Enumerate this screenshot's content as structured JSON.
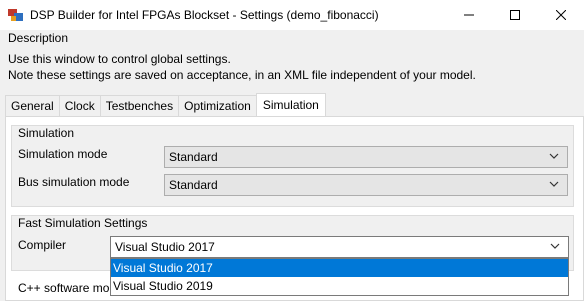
{
  "window": {
    "title": "DSP Builder for Intel FPGAs Blockset - Settings (demo_fibonacci)",
    "controls": [
      "minimize-icon",
      "maximize-icon",
      "close-icon"
    ]
  },
  "description": {
    "label": "Description",
    "line1": "Use this window to control global settings.",
    "line2": "Note these settings are saved on acceptance, in an XML file independent of your model."
  },
  "tabs": [
    {
      "label": "General",
      "active": false
    },
    {
      "label": "Clock",
      "active": false
    },
    {
      "label": "Testbenches",
      "active": false
    },
    {
      "label": "Optimization",
      "active": false
    },
    {
      "label": "Simulation",
      "active": true
    }
  ],
  "simulation": {
    "title": "Simulation",
    "mode_label": "Simulation mode",
    "mode_value": "Standard",
    "bus_label": "Bus simulation mode",
    "bus_value": "Standard"
  },
  "fast_sim": {
    "title": "Fast Simulation Settings",
    "compiler_label": "Compiler",
    "compiler_value": "Visual Studio 2017",
    "options": [
      "Visual Studio 2017",
      "Visual Studio 2019"
    ],
    "selected_option": "Visual Studio 2017"
  },
  "cpp_label": "C++ software mo"
}
